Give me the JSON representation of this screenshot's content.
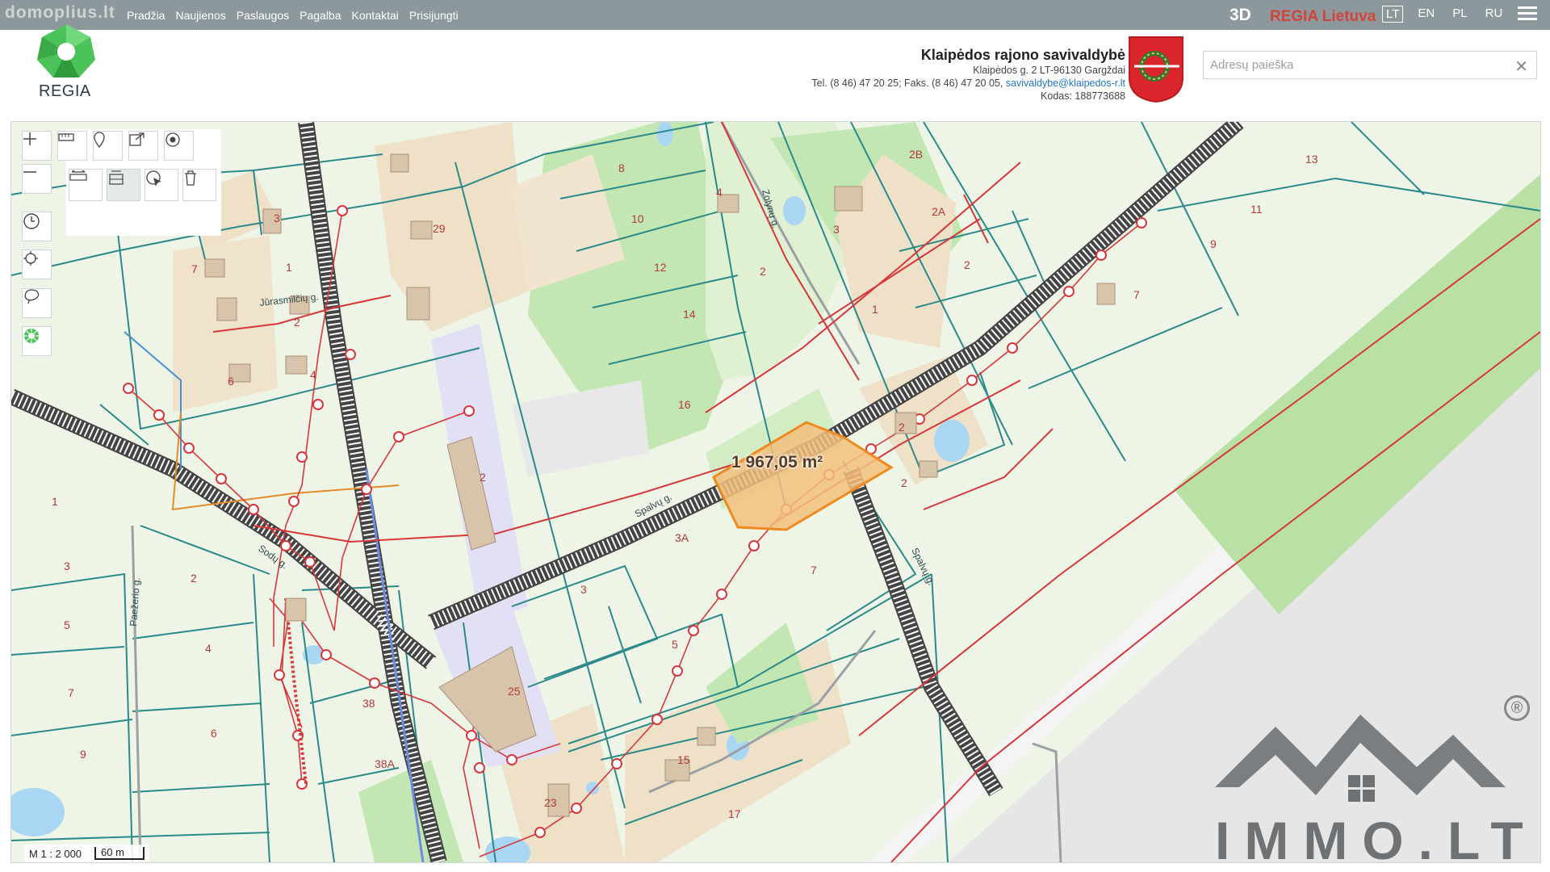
{
  "nav": {
    "brand": "domoplius.lt",
    "items": [
      "Pradžia",
      "Naujienos",
      "Paslaugos",
      "Pagalba",
      "Kontaktai",
      "Prisijungti"
    ],
    "mode_3d": "3D",
    "regia": "REGIA Lietuva",
    "languages": [
      "LT",
      "EN",
      "PL",
      "RU"
    ],
    "active_language": "LT"
  },
  "header": {
    "logo_text": "REGIA",
    "municipality": "Klaipėdos rajono savivaldybė",
    "address": "Klaipėdos g. 2 LT-96130 Gargždai",
    "phone": "Tel. (8 46) 47 20 25; Faks. (8 46) 47 20 05, ",
    "email": "savivaldybe@klaipedos-r.lt",
    "code": "Kodas: 188773688"
  },
  "search": {
    "placeholder": "Adresų paieška",
    "clear_icon": "close-icon"
  },
  "map": {
    "selected_area": "1 967,05 m²",
    "scale_ratio": "M 1 : 2 000",
    "scale_bar": "60 m",
    "streets": [
      "Jūrasmilčių g.",
      "Zolynų g.",
      "Spalvų g.",
      "Spalvų g.",
      "Sodų g.",
      "Paežerio g."
    ],
    "parcels": [
      "8",
      "4",
      "10",
      "12",
      "14",
      "2",
      "16",
      "3",
      "1",
      "2B",
      "2A",
      "2",
      "13",
      "11",
      "9",
      "7",
      "29",
      "3",
      "7",
      "1",
      "2",
      "6",
      "4",
      "1",
      "3",
      "5",
      "7",
      "9",
      "2",
      "4",
      "6",
      "2",
      "3A",
      "3",
      "7",
      "5",
      "25",
      "38",
      "38A",
      "15",
      "23",
      "17",
      "2",
      "2"
    ]
  },
  "toolbar": {
    "icons": [
      "zoom-in-icon",
      "zoom-out-icon",
      "measure-icon",
      "pin-icon",
      "share-icon",
      "target-icon",
      "measure-distance-icon",
      "measure-area-icon",
      "select-icon",
      "delete-icon",
      "history-icon",
      "locate-icon",
      "lasso-icon",
      "layers-icon"
    ]
  },
  "watermark": {
    "text": "IMMO.LT",
    "registered": "®"
  },
  "colors": {
    "nav": "#8d989c",
    "regia_red": "#d2433a",
    "parcel_line": "#2a8a8a",
    "forest": "#b7e0a3",
    "building_area": "#ecdcc2",
    "selected_parcel": "#f3c07d",
    "railway": "#7a7a7a",
    "utility_red": "#d8363a"
  }
}
